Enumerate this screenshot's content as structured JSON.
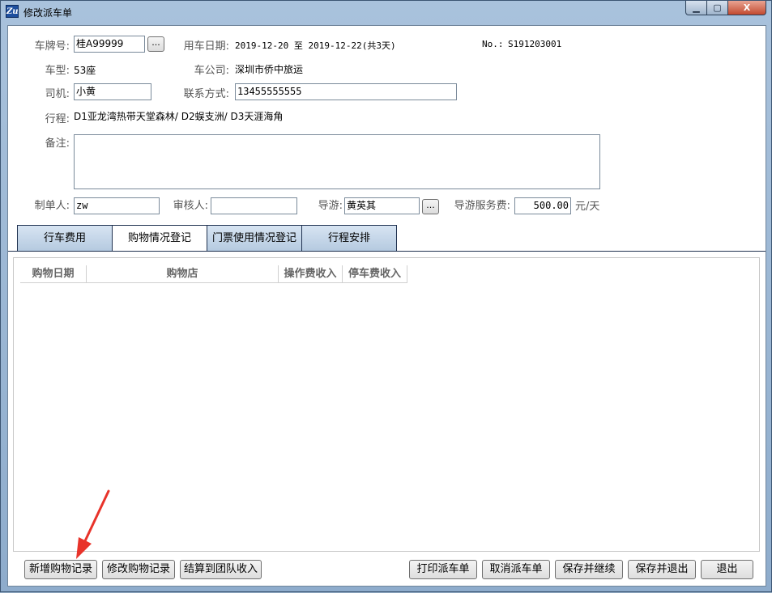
{
  "window": {
    "title": "修改派车单",
    "app_icon": "zu-app-icon",
    "min_glyph": "▁",
    "max_glyph": "▢",
    "close_glyph": "X"
  },
  "form": {
    "plate_label": "车牌号:",
    "plate_value": "桂A99999",
    "date_label": "用车日期:",
    "date_value": "2019-12-20 至 2019-12-22(共3天)",
    "no_label": "No.:",
    "no_value": "S191203001",
    "type_label": "车型:",
    "type_value": "53座",
    "company_label": "车公司:",
    "company_value": "深圳市侨中旅运",
    "driver_label": "司机:",
    "driver_value": "小黄",
    "contact_label": "联系方式:",
    "contact_value": "13455555555",
    "route_label": "行程:",
    "route_value": "D1亚龙湾热带天堂森林/ D2蜈支洲/ D3天涯海角",
    "remark_label": "备注:",
    "remark_value": "",
    "maker_label": "制单人:",
    "maker_value": "zw",
    "reviewer_label": "审核人:",
    "reviewer_value": "",
    "guide_label": "导游:",
    "guide_value": "黄英其",
    "fee_label": "导游服务费:",
    "fee_value": "500.00",
    "fee_unit": "元/天",
    "browse_label": "..."
  },
  "tabs": [
    "行车费用",
    "购物情况登记",
    "门票使用情况登记",
    "行程安排"
  ],
  "active_tab": 1,
  "grid": {
    "columns": [
      "购物日期",
      "购物店",
      "操作费收入",
      "停车费收入"
    ],
    "rows": []
  },
  "buttons": {
    "add": "新增购物记录",
    "edit": "修改购物记录",
    "settle": "结算到团队收入",
    "print": "打印派车单",
    "cancel": "取消派车单",
    "save_continue": "保存并继续",
    "save_exit": "保存并退出",
    "exit": "退出"
  },
  "colors": {
    "annotation_arrow": "#e8332a",
    "tab_border": "#203250"
  }
}
